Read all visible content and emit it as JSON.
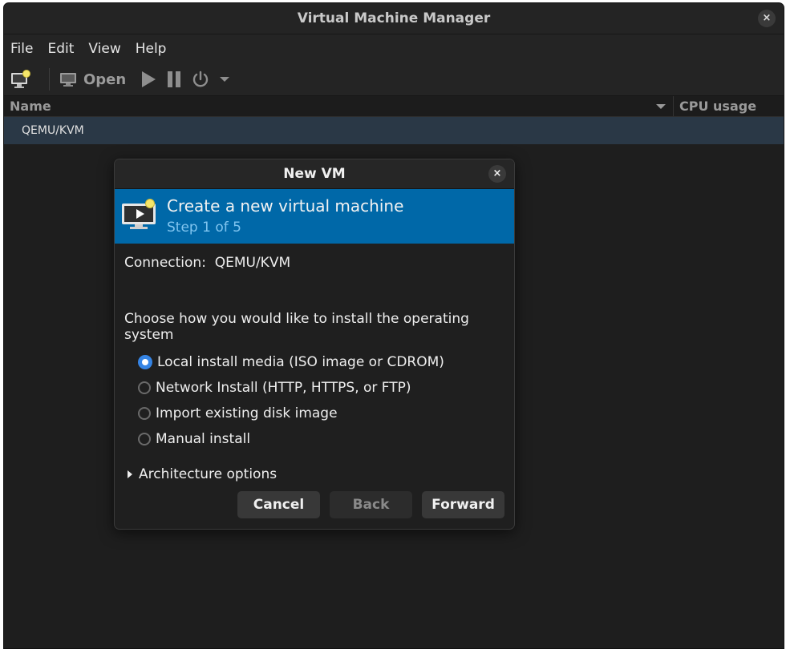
{
  "window": {
    "title": "Virtual Machine Manager",
    "close_glyph": "×"
  },
  "menu": [
    "File",
    "Edit",
    "View",
    "Help"
  ],
  "toolbar": {
    "open_label": "Open",
    "icons": [
      "new-vm-icon",
      "monitor-icon",
      "play-icon",
      "pause-icon",
      "power-icon",
      "dropdown-icon"
    ]
  },
  "list": {
    "col_name": "Name",
    "col_cpu": "CPU usage",
    "rows": [
      "QEMU/KVM"
    ]
  },
  "dialog": {
    "title": "New VM",
    "close_glyph": "×",
    "banner_heading": "Create a new virtual machine",
    "banner_step": "Step 1 of 5",
    "connection": "Connection:  QEMU/KVM",
    "question": "Choose how you would like to install the operating system",
    "options": [
      {
        "label": "Local install media (ISO image or CDROM)",
        "checked": true
      },
      {
        "label": "Network Install (HTTP, HTTPS, or FTP)",
        "checked": false
      },
      {
        "label": "Import existing disk image",
        "checked": false
      },
      {
        "label": "Manual install",
        "checked": false
      }
    ],
    "expander": "Architecture options",
    "buttons": {
      "cancel": "Cancel",
      "back": "Back",
      "forward": "Forward"
    }
  },
  "colors": {
    "banner": "#0068a8",
    "selected_row": "#2a3846",
    "radio_accent": "#3584e4"
  }
}
